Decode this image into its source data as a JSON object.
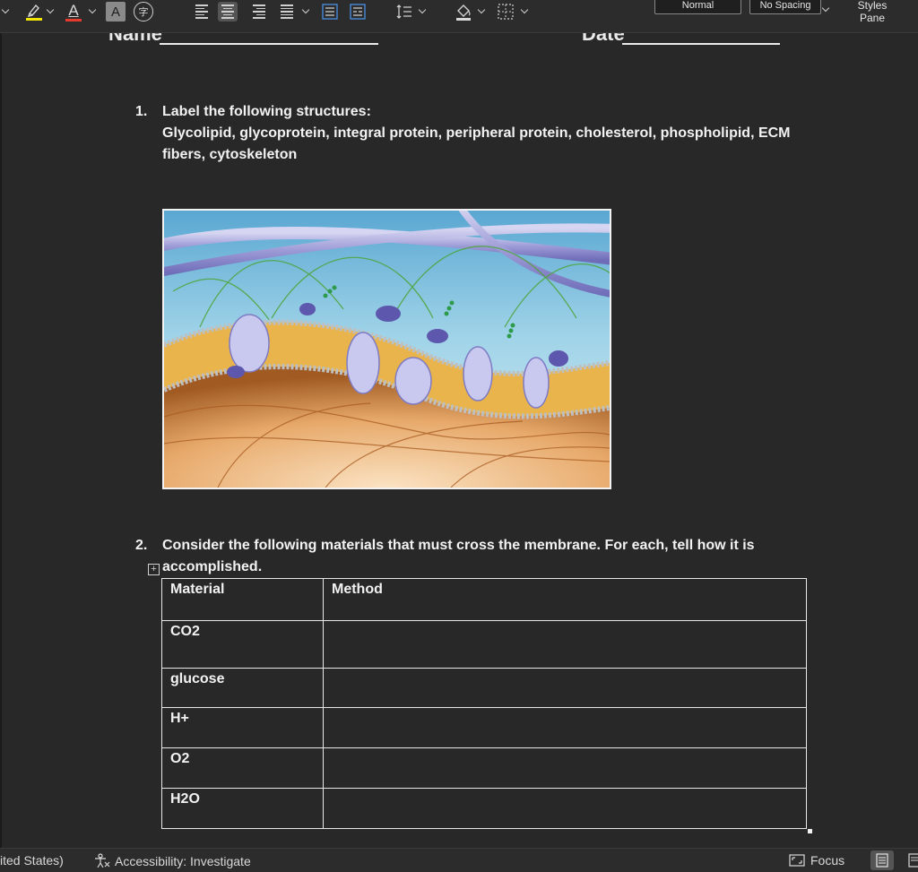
{
  "ribbon": {
    "styles": {
      "normal": "Normal",
      "no_spacing": "No Spacing"
    },
    "styles_pane": {
      "line1": "Styles",
      "line2": "Pane"
    },
    "font_color_letter": "A",
    "char_shading_letter": "A",
    "enclose_char": "字",
    "colors": {
      "highlight": "#f2e600",
      "font_color": "#e33b2e"
    }
  },
  "document": {
    "name_label": "Name",
    "date_label": "Date",
    "q1": {
      "number": "1.",
      "line1": "Label the following structures:",
      "line2": "Glycolipid, glycoprotein, integral protein, peripheral protein, cholesterol, phospholipid, ECM",
      "line3": "fibers, cytoskeleton"
    },
    "figure_alt": "cell-membrane-illustration",
    "q2": {
      "number": "2.",
      "line1": "Consider the following materials that must cross the membrane. For each, tell how it is",
      "line2": "accomplished."
    },
    "table": {
      "headers": [
        "Material",
        "Method"
      ],
      "rows": [
        [
          "CO2",
          ""
        ],
        [
          "glucose",
          ""
        ],
        [
          "H+",
          ""
        ],
        [
          "O2",
          ""
        ],
        [
          "H2O",
          ""
        ]
      ]
    }
  },
  "status_bar": {
    "language": "ited States)",
    "accessibility": "Accessibility: Investigate",
    "focus": "Focus"
  }
}
